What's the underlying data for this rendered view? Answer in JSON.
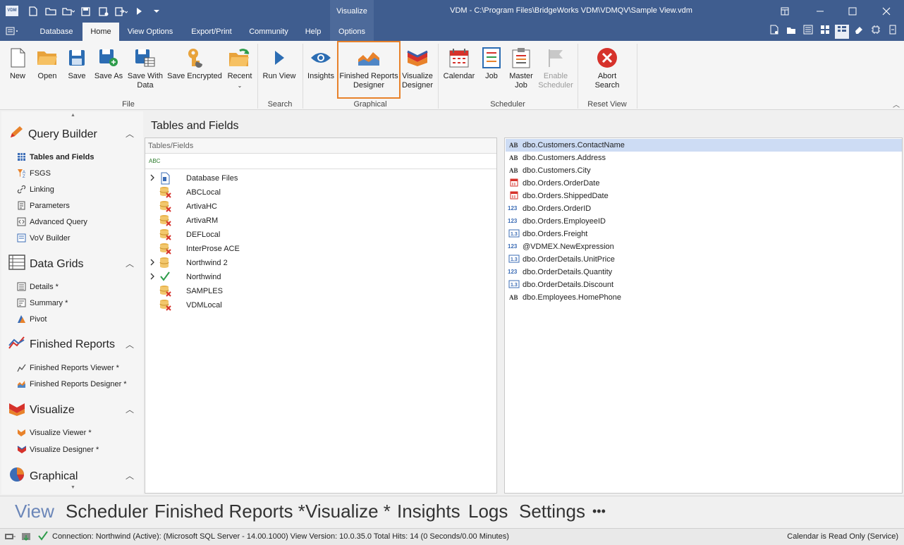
{
  "titlebar": {
    "app_badge": "VDM",
    "context_tab": "Visualize",
    "window_title": "VDM - C:\\Program Files\\BridgeWorks VDM\\VDMQV\\Sample View.vdm"
  },
  "tabs": {
    "database": "Database",
    "home": "Home",
    "view_options": "View Options",
    "export_print": "Export/Print",
    "community": "Community",
    "help": "Help",
    "options": "Options"
  },
  "ribbon": {
    "new": "New",
    "open": "Open",
    "save": "Save",
    "save_as": "Save As",
    "save_with_data_1": "Save With",
    "save_with_data_2": "Data",
    "save_encrypted": "Save Encrypted",
    "recent": "Recent",
    "group_file": "File",
    "run_view": "Run View",
    "group_search": "Search",
    "insights": "Insights",
    "frd_1": "Finished Reports",
    "frd_2": "Designer",
    "vd_1": "Visualize",
    "vd_2": "Designer",
    "group_graphical": "Graphical",
    "calendar": "Calendar",
    "job": "Job",
    "master_job_1": "Master",
    "master_job_2": "Job",
    "enable_scheduler_1": "Enable",
    "enable_scheduler_2": "Scheduler",
    "group_scheduler": "Scheduler",
    "abort_1": "Abort",
    "abort_2": "Search",
    "group_reset": "Reset View"
  },
  "leftnav": {
    "query_builder": "Query Builder",
    "tables_and_fields": "Tables and Fields",
    "fsgs": "FSGS",
    "linking": "Linking",
    "parameters": "Parameters",
    "advanced_query": "Advanced Query",
    "vov_builder": "VoV Builder",
    "data_grids": "Data Grids",
    "details": "Details *",
    "summary": "Summary *",
    "pivot": "Pivot",
    "finished_reports": "Finished Reports",
    "fr_viewer": "Finished Reports Viewer *",
    "fr_designer": "Finished Reports Designer *",
    "visualize": "Visualize",
    "vis_viewer": "Visualize Viewer *",
    "vis_designer": "Visualize Designer *",
    "graphical": "Graphical"
  },
  "main": {
    "title": "Tables and Fields",
    "tree_header": "Tables/Fields",
    "filter_glyph": "ABC",
    "tree": [
      {
        "label": "Database Files",
        "expandable": true,
        "status": "file"
      },
      {
        "label": "ABCLocal",
        "expandable": false,
        "status": "error"
      },
      {
        "label": "ArtivaHC",
        "expandable": false,
        "status": "error"
      },
      {
        "label": "ArtivaRM",
        "expandable": false,
        "status": "error"
      },
      {
        "label": "DEFLocal",
        "expandable": false,
        "status": "error"
      },
      {
        "label": "InterProse ACE",
        "expandable": false,
        "status": "error"
      },
      {
        "label": "Northwind 2",
        "expandable": true,
        "status": "db"
      },
      {
        "label": "Northwind",
        "expandable": true,
        "status": "ok"
      },
      {
        "label": "SAMPLES",
        "expandable": false,
        "status": "error"
      },
      {
        "label": "VDMLocal",
        "expandable": false,
        "status": "error"
      }
    ],
    "fields": [
      {
        "type": "AB",
        "label": "dbo.Customers.ContactName",
        "selected": true
      },
      {
        "type": "AB",
        "label": "dbo.Customers.Address"
      },
      {
        "type": "AB",
        "label": "dbo.Customers.City"
      },
      {
        "type": "date",
        "label": "dbo.Orders.OrderDate"
      },
      {
        "type": "date",
        "label": "dbo.Orders.ShippedDate"
      },
      {
        "type": "123",
        "label": "dbo.Orders.OrderID"
      },
      {
        "type": "123",
        "label": "dbo.Orders.EmployeeID"
      },
      {
        "type": "1.3",
        "label": "dbo.Orders.Freight"
      },
      {
        "type": "123",
        "label": "@VDMEX.NewExpression"
      },
      {
        "type": "1.3",
        "label": "dbo.OrderDetails.UnitPrice"
      },
      {
        "type": "123",
        "label": "dbo.OrderDetails.Quantity"
      },
      {
        "type": "1.3",
        "label": "dbo.OrderDetails.Discount"
      },
      {
        "type": "AB",
        "label": "dbo.Employees.HomePhone"
      }
    ]
  },
  "bottomnav": {
    "view": "View",
    "scheduler": "Scheduler",
    "finished_reports": "Finished Reports *",
    "visualize": "Visualize *",
    "insights": "Insights",
    "logs": "Logs",
    "settings": "Settings",
    "more": "•••"
  },
  "status": {
    "left": "Connection: Northwind (Active): (Microsoft SQL Server - 14.00.1000) View Version: 10.0.35.0   Total Hits: 14 (0 Seconds/0.00 Minutes)",
    "right": "Calendar is Read Only (Service)"
  },
  "colors": {
    "titlebar": "#3f5d8f",
    "highlight_border": "#e8822b",
    "selected_row": "#cddcf4",
    "active_bottom_nav": "#6b86b8"
  }
}
